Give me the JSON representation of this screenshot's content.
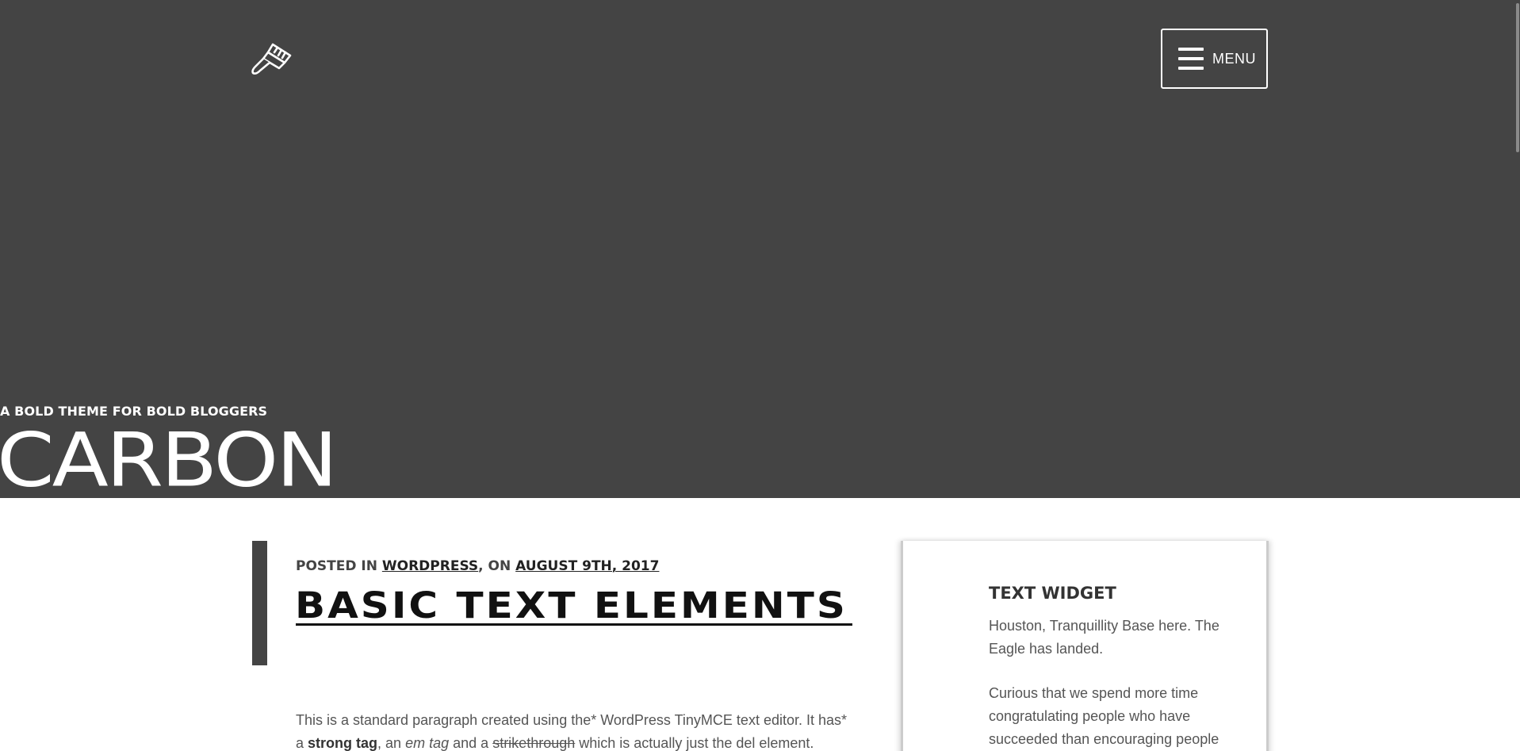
{
  "colors": {
    "hero_background": "#444444",
    "hero_text": "#ffffff",
    "accent_bar": "#444444",
    "title_text": "#111111",
    "body_text": "#555555"
  },
  "header": {
    "logo_icon": "paintbrush-icon",
    "menu": {
      "icon": "hamburger-icon",
      "label": "MENU"
    },
    "tagline": "A BOLD THEME FOR BOLD BLOGGERS",
    "site_title": "CARBON"
  },
  "post": {
    "meta": {
      "posted_in_prefix": "POSTED IN",
      "category": "WORDPRESS",
      "on_text": ", ON",
      "date": "AUGUST 9TH, 2017"
    },
    "title": "BASIC TEXT ELEMENTS",
    "body": {
      "line1": "This is a standard paragraph created using the* WordPress TinyMCE text editor. It has*",
      "line2_a": "a",
      "strong_text": "strong tag",
      "line2_b": ", an",
      "em_text": "em tag",
      "line2_c": "and a",
      "del_text": "strikethrough",
      "line2_d": "which is actually just the del element."
    }
  },
  "sidebar": {
    "widget": {
      "title": "TEXT WIDGET",
      "paragraph1": "Houston, Tranquillity Base here. The Eagle has landed.",
      "paragraph2": "Curious that we spend more time congratulating people who have succeeded than encouraging people"
    }
  }
}
